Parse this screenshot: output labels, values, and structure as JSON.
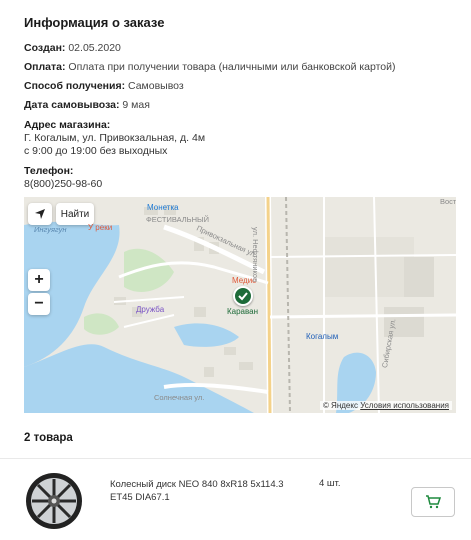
{
  "order": {
    "title": "Информация о заказе",
    "created_label": "Создан:",
    "created_value": "02.05.2020",
    "payment_label": "Оплата:",
    "payment_value": "Оплата при получении товара (наличными или банковской картой)",
    "delivery_label": "Способ получения:",
    "delivery_value": "Самовывоз",
    "pickup_date_label": "Дата самовывоза:",
    "pickup_date_value": "9 мая",
    "address_label": "Адрес магазина:",
    "address_line1": "Г. Когалым, ул. Привокзальная, д. 4м",
    "address_line2": "с 9:00 до 19:00 без выходных",
    "phone_label": "Телефон:",
    "phone_value": "8(800)250-98-60"
  },
  "map": {
    "find_button": "Найти",
    "zoom_in": "+",
    "zoom_out": "−",
    "labels": {
      "u_reki": "У реки",
      "moneta": "Монетка",
      "festival": "ФЕСТИВАЛЬНЫЙ",
      "privokz": "Привокзальная ул.",
      "medis": "Медис",
      "karavan": "Караван",
      "druzhba": "Дружба",
      "kogalym": "Когалым",
      "neftyanikov": "ул. Нефтяников",
      "solnechnaya": "Солнечная ул.",
      "inguyagun": "Ингуягун",
      "vost": "Вост",
      "sibirskaya": "Сибирская ул."
    },
    "copyright": "© Яндекс",
    "terms": "Условия использования"
  },
  "items_section": {
    "title": "2 товара"
  },
  "product": {
    "name": "Колесный диск NEO 840 8xR18 5x114.3 ET45 DIA67.1",
    "qty": "4 шт."
  },
  "colors": {
    "accent_green": "#1e6b39",
    "water": "#a9d4f0",
    "road": "#ffffff"
  },
  "icons": {
    "locate": "locate-arrow-icon",
    "cart": "cart-icon",
    "pin": "store-pin-icon"
  }
}
